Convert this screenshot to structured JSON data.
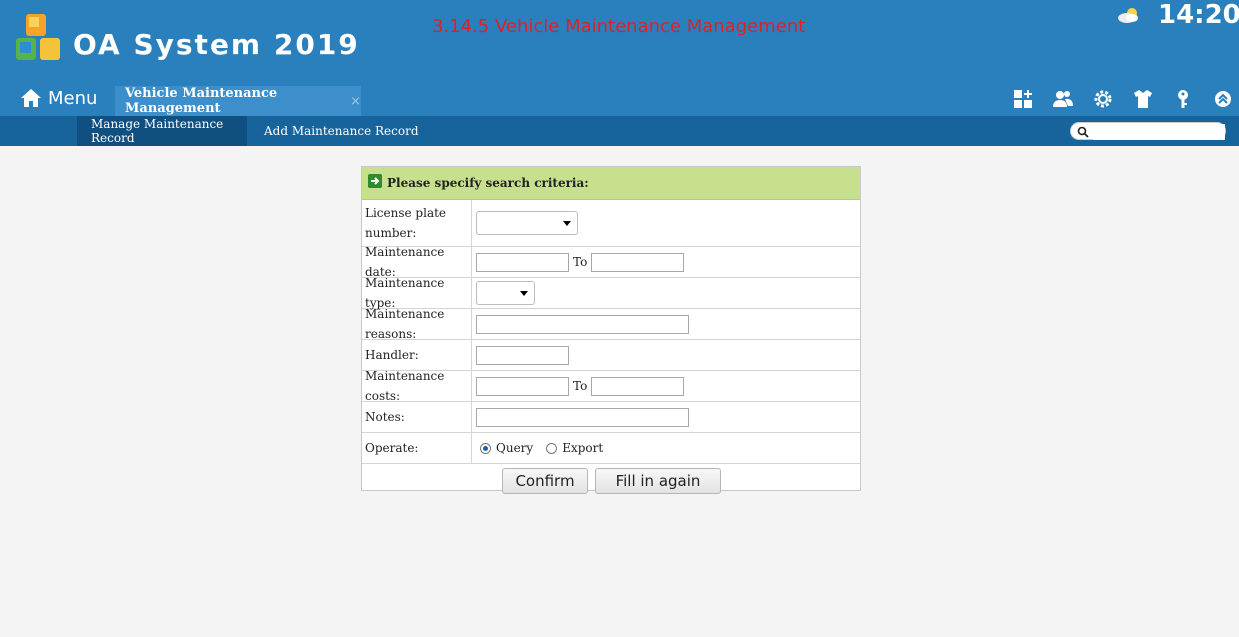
{
  "header": {
    "app_title": "OA System 2019",
    "module_title": "3.14.5 Vehicle Maintenance Management",
    "clock": "14:20",
    "menu_label": "Menu",
    "active_tab": "Vehicle Maintenance Management",
    "tab_close": "×",
    "icons": [
      "add-widget-icon",
      "users-icon",
      "settings-icon",
      "shirt-icon",
      "key-icon",
      "collapse-up-icon"
    ]
  },
  "subnav": {
    "items": [
      "Manage Maintenance Record",
      "Add Maintenance Record"
    ],
    "search_placeholder": ""
  },
  "form": {
    "heading": "Please specify search criteria:",
    "license_label": "License plate number:",
    "date_label": "Maintenance date:",
    "to_label": "To",
    "type_label": "Maintenance type:",
    "reasons_label": "Maintenance reasons:",
    "handler_label": "Handler:",
    "costs_label": "Maintenance costs:",
    "notes_label": "Notes:",
    "operate_label": "Operate:",
    "op_query": "Query",
    "op_export": "Export",
    "selected_operation": "Query",
    "confirm_label": "Confirm",
    "reset_label": "Fill in again"
  },
  "colors": {
    "header_bg": "#2a7fbd",
    "subnav_bg": "#17639b",
    "panel_head_bg": "#c6e08e",
    "module_title": "#d9232b"
  }
}
